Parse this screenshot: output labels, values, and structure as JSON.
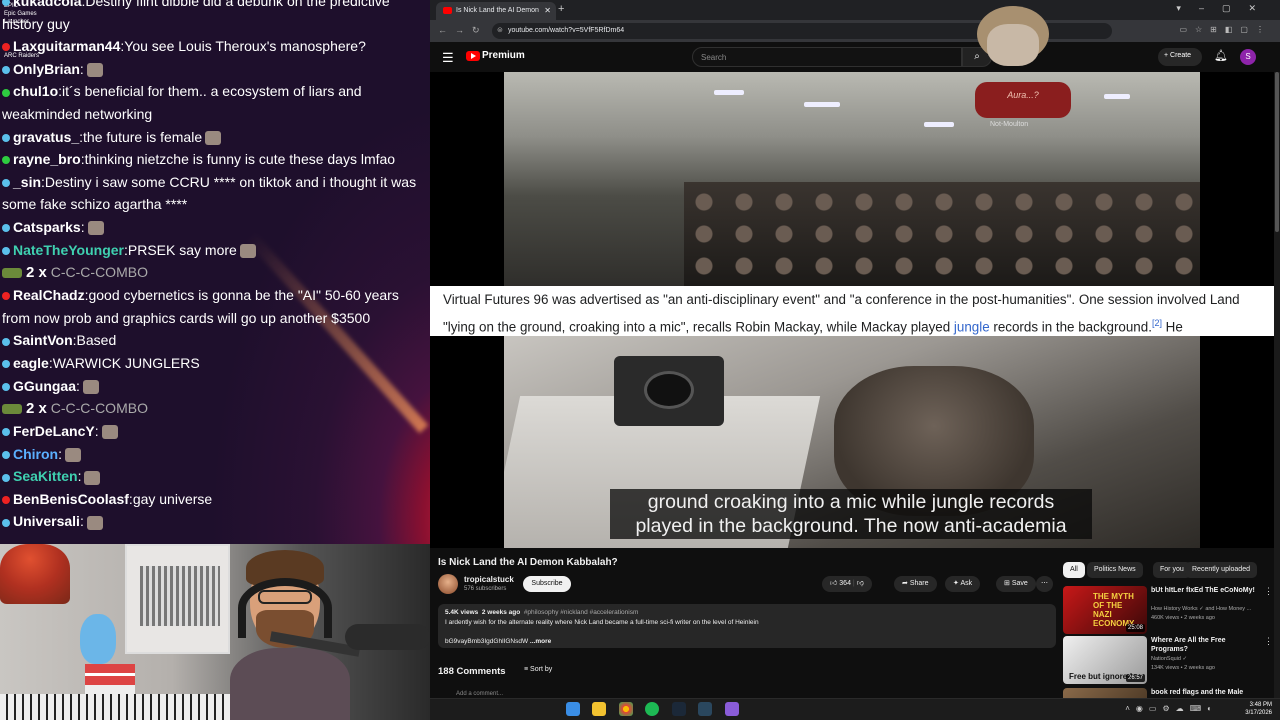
{
  "chat": {
    "messages": [
      {
        "user": "kukadcola",
        "text": "Destiny flint dibble did a debunk on the predictive history guy",
        "color": "#ffffff",
        "badge": "#5bc0eb",
        "wrap": true
      },
      {
        "user": "Laxguitarman44",
        "text": "You see Louis Theroux's manosphere?",
        "color": "#ffffff",
        "badge": "#e22",
        "wrap": false
      },
      {
        "user": "OnlyBrian",
        "text": "",
        "color": "#ffffff",
        "badge": "#5bc0eb",
        "wrap": false,
        "emote": true
      },
      {
        "user": "chul1o",
        "text": "it´s beneficial for them.. a ecosystem of liars and weakminded  networking",
        "color": "#ffffff",
        "badge": "#2ecc40",
        "wrap": true
      },
      {
        "user": "gravatus_",
        "text": "the future is female",
        "color": "#ffffff",
        "badge": "#5bc0eb",
        "wrap": false,
        "emote": true
      },
      {
        "user": "rayne_bro",
        "text": "thinking nietzche is funny is cute these days lmfao",
        "color": "#ffffff",
        "badge": "#2ecc40",
        "wrap": false
      },
      {
        "user": "_sin",
        "text": "Destiny i saw some CCRU **** on tiktok and i thought it was some fake schizo agartha ****",
        "color": "#ffffff",
        "badge": "#5bc0eb",
        "wrap": true
      },
      {
        "user": "Catsparks",
        "text": "",
        "color": "#ffffff",
        "badge": "#5bc0eb",
        "wrap": false,
        "emote": true
      },
      {
        "user": "NateTheYounger",
        "text": "PRSEK say more",
        "color": "#3fd0b0",
        "badge": "#5bc0eb",
        "wrap": false,
        "emote": true
      },
      {
        "combo": true,
        "count": "2 x",
        "label": "C-C-C-COMBO"
      },
      {
        "user": "RealChadz",
        "text": "good cybernetics is gonna be the \"AI\" 50-60 years from now prob and graphics cards will go up another $3500",
        "color": "#ffffff",
        "badge": "#e22",
        "wrap": true
      },
      {
        "user": "SaintVon",
        "text": "Based",
        "color": "#ffffff",
        "badge": "#5bc0eb",
        "wrap": false
      },
      {
        "user": "eagle",
        "text": "WARWICK  JUNGLERS",
        "color": "#ffffff",
        "badge": "#5bc0eb",
        "wrap": false
      },
      {
        "user": "GGungaa",
        "text": "",
        "color": "#ffffff",
        "badge": "#5bc0eb",
        "wrap": false,
        "emote": true
      },
      {
        "combo": true,
        "count": "2 x",
        "label": "C-C-C-COMBO"
      },
      {
        "user": "FerDeLancY",
        "text": "",
        "color": "#ffffff",
        "badge": "#5bc0eb",
        "wrap": false,
        "emote": true
      },
      {
        "user": "Chiron",
        "text": "",
        "color": "#5bb0ff",
        "badge": "#5bc0eb",
        "wrap": false,
        "emote": true
      },
      {
        "user": "SeaKitten",
        "text": "",
        "color": "#3fd0b0",
        "badge": "#5bc0eb",
        "wrap": false,
        "emote": true
      },
      {
        "user": "BenBenisCoolasf",
        "text": "gay universe",
        "color": "#ffffff",
        "badge": "#e22",
        "wrap": false
      },
      {
        "user": "Universali",
        "text": "",
        "color": "#ffffff",
        "badge": "#5bc0eb",
        "wrap": false,
        "emote": true
      }
    ],
    "desktop_icons": [
      "EPIC",
      "Epic Games Launcher",
      "ARC Raiders"
    ]
  },
  "browser": {
    "tab_title": "Is Nick Land the AI Demon",
    "url": "youtube.com/watch?v=5VfF5RfDm64"
  },
  "yt": {
    "logo_text": "Premium",
    "search_placeholder": "Search",
    "create_label": "Create",
    "avatar_letter": "S",
    "overlay_sign": "Aura...?",
    "overlay_label": "Not-Moulton",
    "wiki_text_1": "Virtual Futures 96 was advertised as \"an anti-disciplinary event\" and \"a conference in the post-humanities\". One session involved Land \"lying on the ground, croaking into a mic\", recalls Robin Mackay, while Mackay played ",
    "wiki_link": "jungle",
    "wiki_text_2": " records in the background.",
    "wiki_ref": "[2]",
    "wiki_text_3": " He",
    "caption_line1": "ground croaking into a mic while jungle records",
    "caption_line2": "played in the background. The now anti-academia",
    "video_title": "Is Nick Land the AI Demon Kabbalah?",
    "channel": "tropicalstuck",
    "subscribers": "576 subscribers",
    "subscribe_label": "Subscribe",
    "likes": "364",
    "share_label": "Share",
    "ask_label": "Ask",
    "save_label": "Save",
    "views": "5.4K views",
    "age": "2 weeks ago",
    "tags": "#philosophy #nickland #accelerationism",
    "description": "I ardently wish for the alternate reality where Nick Land became a full-time sci-fi writer on the level of Heinlein",
    "desc_line2": "bG9vayBmb3IgdGhlIGNsdW⁠",
    "more_label": "...more",
    "comments_count": "188 Comments",
    "sort_label": "Sort by",
    "add_comment": "Add a comment...",
    "chips": [
      "All",
      "Politics News",
      "For you",
      "Recently uploaded"
    ],
    "recommendations": [
      {
        "title": "bUt hItLer fIxEd ThE eCoNoMy!",
        "channel": "How History Works ✓ and How Money ...",
        "stats": "460K views • 2 weeks ago",
        "duration": "25:08",
        "thumb_text": "THE MYTH OF THE NAZI ECONOMY"
      },
      {
        "title": "Where Are All the Free Programs?",
        "channel": "NationSquid ✓",
        "stats": "134K views • 2 weeks ago",
        "duration": "26:57",
        "thumb_text": "Free but ignored"
      },
      {
        "title": "book red flags and the Male",
        "channel": "",
        "stats": "",
        "duration": "",
        "thumb_text": ""
      }
    ]
  },
  "taskbar": {
    "time": "3:48 PM",
    "date": "3/17/2026"
  }
}
